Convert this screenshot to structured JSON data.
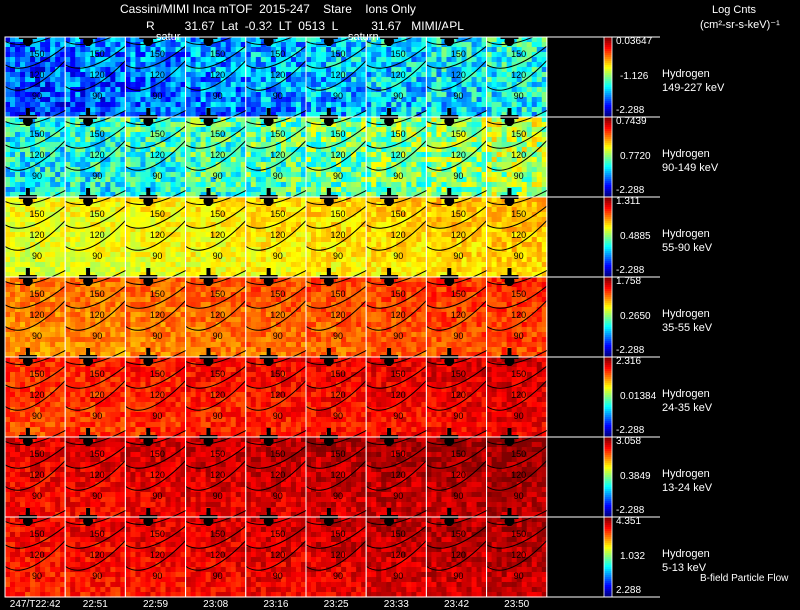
{
  "header": {
    "line1": "Cassini/MIMI Inca mTOF  2015-247    Stare    Ions Only",
    "line2": "R         31.67  Lat  -0.32  LT  0513  L          31.67   MIMI/APL",
    "units_title": "Log Cnts",
    "units": "(cm²-sr-s-keV)⁻¹"
  },
  "overlay_labels": {
    "saturn_1": "satur",
    "saturn_2": "saturn"
  },
  "contour_labels": [
    "150",
    "120",
    "90"
  ],
  "footer_note": "B-field Particle Flow",
  "colors": {
    "background": "#000000",
    "frame": "#ffffff",
    "contour": "#000000"
  },
  "chart_data": {
    "type": "heatmap",
    "title": "Cassini/MIMI Inca mTOF  2015-247    Stare    Ions Only",
    "x_tick_labels": [
      "247/T22:42",
      "22:51",
      "22:59",
      "23:08",
      "23:16",
      "23:25",
      "23:33",
      "23:42",
      "23:50"
    ],
    "columns": 9,
    "rows": [
      {
        "species": "Hydrogen",
        "energy": "149-227 keV",
        "cbar_max": "0.03647",
        "cbar_mid": "-1.126",
        "cbar_min": "-2.288",
        "level": 0.22
      },
      {
        "species": "Hydrogen",
        "energy": "90-149 keV",
        "cbar_max": "0.7439",
        "cbar_mid": "0.7720",
        "cbar_min": "-2.288",
        "level": 0.4
      },
      {
        "species": "Hydrogen",
        "energy": "55-90 keV",
        "cbar_max": "1.311",
        "cbar_mid": "0.4885",
        "cbar_min": "-2.288",
        "level": 0.62
      },
      {
        "species": "Hydrogen",
        "energy": "35-55 keV",
        "cbar_max": "1.758",
        "cbar_mid": "0.2650",
        "cbar_min": "-2.288",
        "level": 0.76
      },
      {
        "species": "Hydrogen",
        "energy": "24-35 keV",
        "cbar_max": "2.316",
        "cbar_mid": "0.01384",
        "cbar_min": "-2.288",
        "level": 0.84
      },
      {
        "species": "Hydrogen",
        "energy": "13-24 keV",
        "cbar_max": "3.058",
        "cbar_mid": "0.3849",
        "cbar_min": "-2.288",
        "level": 0.9
      },
      {
        "species": "Hydrogen",
        "energy": "5-13 keV",
        "cbar_max": "4.351",
        "cbar_mid": "1.032",
        "cbar_min": "2.288",
        "level": 0.88
      }
    ]
  }
}
